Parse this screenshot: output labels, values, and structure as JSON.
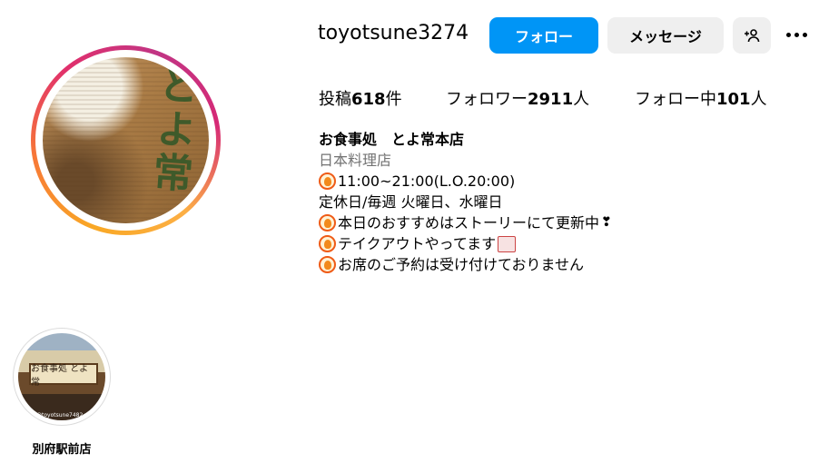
{
  "profile": {
    "username": "toyotsune3274",
    "follow_label": "フォロー",
    "message_label": "メッセージ",
    "avatar_text": "とよ常"
  },
  "stats": {
    "posts_prefix": "投稿",
    "posts_count": "618",
    "posts_suffix": "件",
    "followers_prefix": "フォロワー",
    "followers_count": "2911",
    "followers_suffix": "人",
    "following_prefix": "フォロー中",
    "following_count": "101",
    "following_suffix": "人"
  },
  "bio": {
    "name": "お食事処　とよ常本店",
    "category": "日本料理店",
    "hours": "11:00~21:00(L.O.20:00)",
    "closed": "定休日/毎週 火曜日、水曜日",
    "line1": "本日のおすすめはストーリーにて更新中",
    "line2": "テイクアウトやってます",
    "line3": "お席のご予約は受け付けておりません"
  },
  "highlight": {
    "label": "別府駅前店",
    "sign_text": "お食事処 とよ常",
    "handle_text": "@toyotsune7482"
  },
  "colors": {
    "accent": "#0095f6",
    "button_gray": "#efefef",
    "muted": "#737373"
  },
  "icons": [
    "person-add-icon",
    "more-icon",
    "fire-icon",
    "heart-exclamation-icon",
    "bento-icon"
  ]
}
